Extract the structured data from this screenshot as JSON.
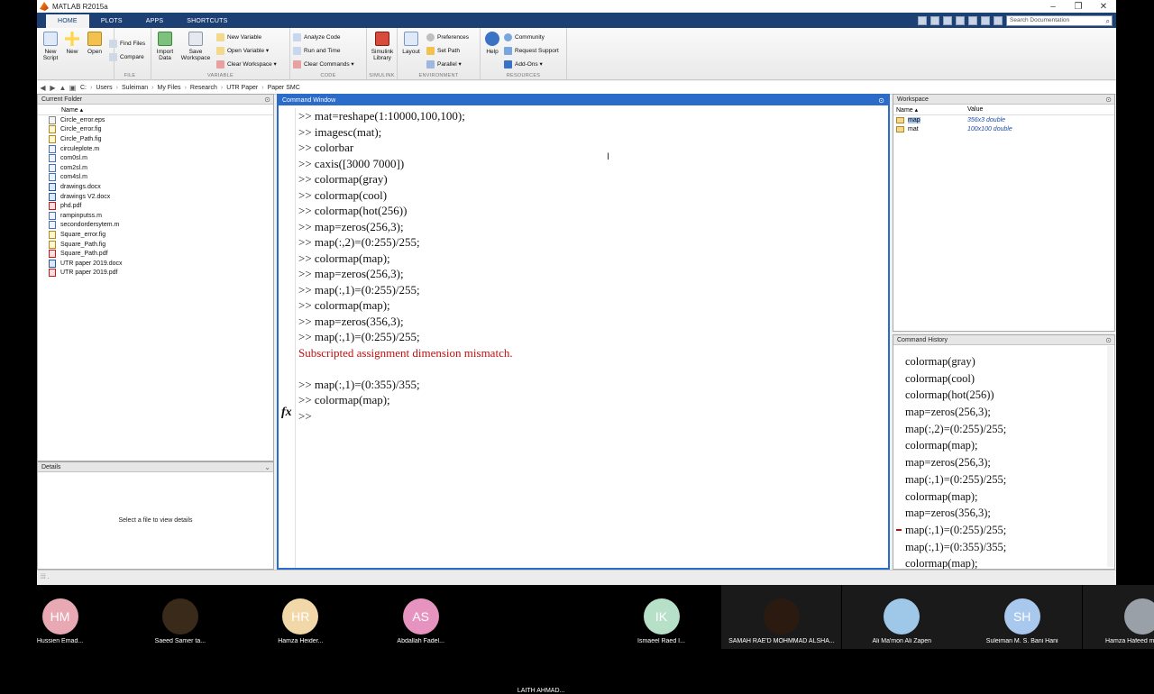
{
  "app": {
    "title": "MATLAB R2015a"
  },
  "window_controls": {
    "minimize": "–",
    "restore": "❐",
    "close": "✕"
  },
  "ribbon_tabs": [
    {
      "label": "HOME"
    },
    {
      "label": "PLOTS"
    },
    {
      "label": "APPS"
    },
    {
      "label": "SHORTCUTS"
    }
  ],
  "search": {
    "placeholder": "Search Documentation"
  },
  "toolstrip": {
    "file": {
      "label": "FILE",
      "new_script": "New Script",
      "new": "New",
      "open": "Open",
      "find_files": "Find Files",
      "compare": "Compare"
    },
    "variable": {
      "label": "VARIABLE",
      "import_data": "Import Data",
      "save_workspace": "Save Workspace",
      "new_variable": "New Variable",
      "open_variable": "Open Variable ▾",
      "clear_workspace": "Clear Workspace ▾"
    },
    "code": {
      "label": "CODE",
      "analyze_code": "Analyze Code",
      "run_and_time": "Run and Time",
      "clear_commands": "Clear Commands ▾"
    },
    "simulink": {
      "label": "SIMULINK",
      "simulink_library": "Simulink Library"
    },
    "environment": {
      "label": "ENVIRONMENT",
      "layout": "Layout",
      "preferences": "Preferences",
      "set_path": "Set Path",
      "parallel": "Parallel ▾"
    },
    "resources": {
      "label": "RESOURCES",
      "help": "Help",
      "community": "Community",
      "request_support": "Request Support",
      "add_ons": "Add-Ons ▾"
    }
  },
  "address": {
    "drive": "C:",
    "parts": [
      "Users",
      "Suleiman",
      "My Files",
      "Research",
      "UTR Paper",
      "Paper SMC"
    ]
  },
  "current_folder": {
    "title": "Current Folder",
    "column": "Name ▴",
    "files": [
      {
        "name": "Circle_error.eps",
        "type": "eps"
      },
      {
        "name": "Circle_error.fig",
        "type": "fig"
      },
      {
        "name": "Circle_Path.fig",
        "type": "fig"
      },
      {
        "name": "circuleplote.m",
        "type": "m"
      },
      {
        "name": "com0sl.m",
        "type": "m"
      },
      {
        "name": "com2sl.m",
        "type": "m"
      },
      {
        "name": "com4sl.m",
        "type": "m"
      },
      {
        "name": "drawings.docx",
        "type": "doc"
      },
      {
        "name": "drawings V2.docx",
        "type": "doc"
      },
      {
        "name": "phd.pdf",
        "type": "pdf"
      },
      {
        "name": "rampinputss.m",
        "type": "m"
      },
      {
        "name": "secondordersytem.m",
        "type": "m"
      },
      {
        "name": "Square_error.fig",
        "type": "fig"
      },
      {
        "name": "Square_Path.fig",
        "type": "fig"
      },
      {
        "name": "Square_Path.pdf",
        "type": "pdf"
      },
      {
        "name": "UTR paper 2019.docx",
        "type": "doc"
      },
      {
        "name": "UTR paper 2019.pdf",
        "type": "pdf"
      }
    ]
  },
  "details": {
    "title": "Details",
    "empty_text": "Select a file to view details"
  },
  "command_window": {
    "title": "Command Window",
    "lines": [
      {
        "text": ">> mat=reshape(1:10000,100,100);",
        "error": false
      },
      {
        "text": ">> imagesc(mat);",
        "error": false
      },
      {
        "text": ">> colorbar",
        "error": false
      },
      {
        "text": ">> caxis([3000 7000])",
        "error": false
      },
      {
        "text": ">> colormap(gray)",
        "error": false
      },
      {
        "text": ">> colormap(cool)",
        "error": false
      },
      {
        "text": ">> colormap(hot(256))",
        "error": false
      },
      {
        "text": ">> map=zeros(256,3);",
        "error": false
      },
      {
        "text": ">> map(:,2)=(0:255)/255;",
        "error": false
      },
      {
        "text": ">> colormap(map);",
        "error": false
      },
      {
        "text": ">> map=zeros(256,3);",
        "error": false
      },
      {
        "text": ">> map(:,1)=(0:255)/255;",
        "error": false
      },
      {
        "text": ">> colormap(map);",
        "error": false
      },
      {
        "text": ">> map=zeros(356,3);",
        "error": false
      },
      {
        "text": ">> map(:,1)=(0:255)/255;",
        "error": false
      },
      {
        "text": "Subscripted assignment dimension mismatch.",
        "error": true
      },
      {
        "text": "",
        "error": false
      },
      {
        "text": ">> map(:,1)=(0:355)/355;",
        "error": false
      },
      {
        "text": ">> colormap(map);",
        "error": false
      },
      {
        "text": ">> ",
        "error": false
      }
    ],
    "fx_symbol": "fx"
  },
  "workspace": {
    "title": "Workspace",
    "col_name": "Name ▴",
    "col_value": "Value",
    "vars": [
      {
        "name": "map",
        "value": "356x3 double",
        "selected": true
      },
      {
        "name": "mat",
        "value": "100x100 double",
        "selected": false
      }
    ]
  },
  "command_history": {
    "title": "Command History",
    "items": [
      {
        "text": "colormap(gray)",
        "error": false
      },
      {
        "text": "colormap(cool)",
        "error": false
      },
      {
        "text": "colormap(hot(256))",
        "error": false
      },
      {
        "text": "map=zeros(256,3);",
        "error": false
      },
      {
        "text": "map(:,2)=(0:255)/255;",
        "error": false
      },
      {
        "text": "colormap(map);",
        "error": false
      },
      {
        "text": "map=zeros(256,3);",
        "error": false
      },
      {
        "text": "map(:,1)=(0:255)/255;",
        "error": false
      },
      {
        "text": "colormap(map);",
        "error": false
      },
      {
        "text": "map=zeros(356,3);",
        "error": false
      },
      {
        "text": "map(:,1)=(0:255)/255;",
        "error": true
      },
      {
        "text": "map(:,1)=(0:355)/355;",
        "error": false
      },
      {
        "text": "colormap(map);",
        "error": false
      }
    ]
  },
  "participants": [
    {
      "initials": "HM",
      "name": "Hussien Emad...",
      "color": "#e8a8b4"
    },
    {
      "initials": "",
      "name": "Saeed Samer ta...",
      "color": "#3a2a1a"
    },
    {
      "initials": "HR",
      "name": "Hamza Heider...",
      "color": "#f2d8a8"
    },
    {
      "initials": "AS",
      "name": "Abdallah Fadel...",
      "color": "#e693c0"
    },
    {
      "initials": "",
      "name": "LAITH AHMAD...",
      "color": ""
    },
    {
      "initials": "IK",
      "name": "Ismaeel Raed I...",
      "color": "#b7e0c8"
    },
    {
      "initials": "",
      "name": "SAMAH RAE'D MOHMMAD ALSHA...",
      "color": "#2a1a10"
    },
    {
      "initials": "",
      "name": "Ali Ma'mon Ali Zapen",
      "color": "#9fc8e8"
    },
    {
      "initials": "SH",
      "name": "Suleiman M. S. Bani Hani",
      "color": "#a9c8ee"
    },
    {
      "initials": "",
      "name": "Hamza Hafeed m.j Anzawi",
      "color": "#9aa0a8"
    }
  ]
}
